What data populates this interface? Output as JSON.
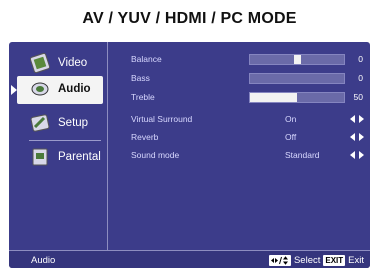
{
  "page_title": "AV / YUV / HDMI / PC MODE",
  "sidebar": {
    "items": [
      {
        "label": "Video",
        "active": false
      },
      {
        "label": "Audio",
        "active": true
      },
      {
        "label": "Setup",
        "active": false
      },
      {
        "label": "Parental",
        "active": false
      }
    ]
  },
  "settings": [
    {
      "name": "Balance",
      "value": "0",
      "level": 0.5
    },
    {
      "name": "Bass",
      "value": "0",
      "level": 0
    },
    {
      "name": "Treble",
      "value": "50",
      "level": 0.5
    },
    {
      "name": "Virtual Surround",
      "value": "On"
    },
    {
      "name": "Reverb",
      "value": "Off"
    },
    {
      "name": "Sound mode",
      "value": "Standard"
    }
  ],
  "footer": {
    "section": "Audio",
    "select_label": "Select",
    "exit_key": "EXIT",
    "exit_label": "Exit"
  },
  "colors": {
    "panel": "#3c3c8a",
    "active_item": "#f4f4f4"
  }
}
